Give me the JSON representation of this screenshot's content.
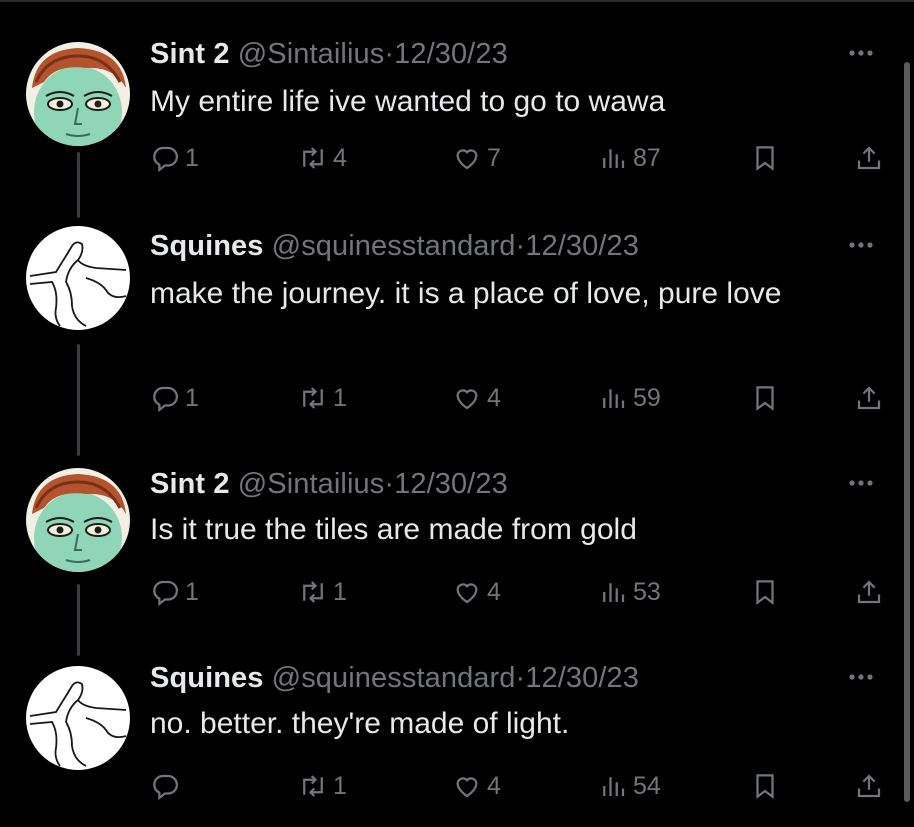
{
  "tweets": [
    {
      "name": "Sint 2",
      "handle": "@Sintailius",
      "sep": "·",
      "date": "12/30/23",
      "text": "My entire life ive wanted to go to wawa",
      "replies": "1",
      "retweets": "4",
      "likes": "7",
      "views": "87",
      "avatar": "redhead-portrait-avatar"
    },
    {
      "name": "Squines",
      "handle": "@squinesstandard",
      "sep": "·",
      "date": "12/30/23",
      "text": "make the journey. it is a place of love, pure love",
      "replies": "1",
      "retweets": "1",
      "likes": "4",
      "views": "59",
      "avatar": "line-drawing-avatar"
    },
    {
      "name": "Sint 2",
      "handle": "@Sintailius",
      "sep": "·",
      "date": "12/30/23",
      "text": "Is it true the tiles are made from gold",
      "replies": "1",
      "retweets": "1",
      "likes": "4",
      "views": "53",
      "avatar": "redhead-portrait-avatar"
    },
    {
      "name": "Squines",
      "handle": "@squinesstandard",
      "sep": "·",
      "date": "12/30/23",
      "text": "no. better. they're made of light.",
      "replies": "",
      "retweets": "1",
      "likes": "4",
      "views": "54",
      "avatar": "line-drawing-avatar"
    }
  ],
  "icons": {
    "more": "more-icon",
    "reply": "reply-icon",
    "retweet": "retweet-icon",
    "like": "heart-icon",
    "views": "views-icon",
    "bookmark": "bookmark-icon",
    "share": "share-icon"
  },
  "colors": {
    "background": "#000000",
    "text": "#e7e9ea",
    "secondary": "#71767b",
    "thread_line": "#3a3d41"
  }
}
